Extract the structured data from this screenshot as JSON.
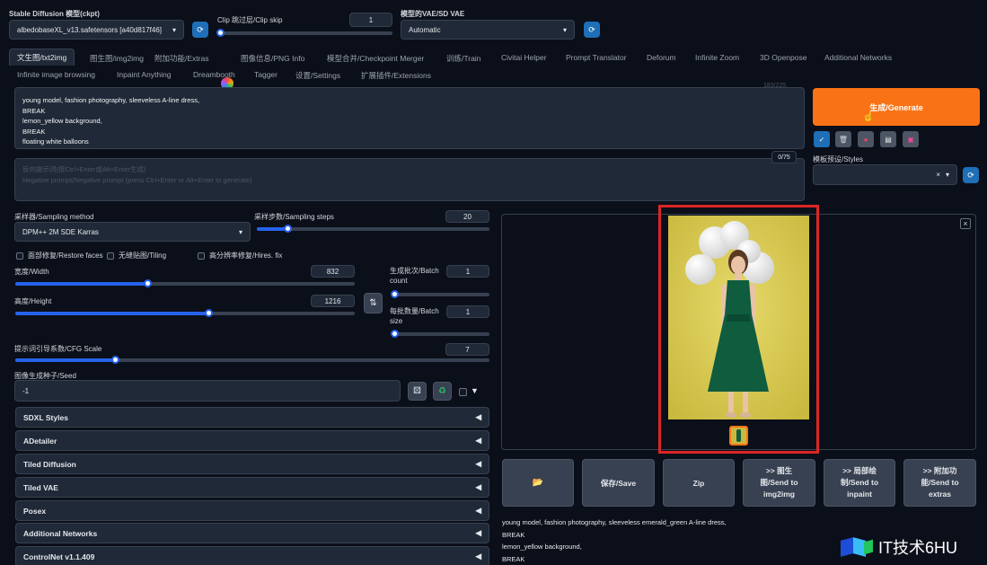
{
  "top": {
    "ckpt_label": "Stable Diffusion 模型(ckpt)",
    "ckpt_value": "albedobaseXL_v13.safetensors [a40d817f46]",
    "clip_label": "Clip 跳过层/Clip skip",
    "clip_value": "1",
    "clip_fraction": 0.0,
    "vae_label": "模型的VAE/SD VAE",
    "vae_value": "Automatic",
    "refresh_glyph": "⟳"
  },
  "tabs_row1": [
    "文生图/txt2img",
    "图生图/img2img",
    "附加功能/Extras",
    "图像信息/PNG Info",
    "模型合并/Checkpoint Merger",
    "训练/Train",
    "Civitai Helper",
    "Prompt Translator",
    "Deforum",
    "Infinite Zoom",
    "3D Openpose",
    "Additional Networks"
  ],
  "tabs_row2": [
    "Infinite image browsing",
    "Inpaint Anything",
    "Dreambooth",
    "Tagger",
    "设置/Settings",
    "扩展插件/Extensions"
  ],
  "prompt": {
    "lines": [
      "young model, fashion photography, sleeveless A-line dress,",
      "BREAK",
      "lemon_yellow background,",
      "BREAK",
      "floating white balloons"
    ],
    "counter": "183/225",
    "neg_placeholder_cn": "反向提示词(按Ctrl+Enter或Alt+Enter生成)",
    "neg_placeholder_en": "Negative prompt(Negative prompt (press Ctrl+Enter or Alt+Enter to generate)",
    "neg_counter": "0/75"
  },
  "generate": {
    "label": "生成/Generate",
    "styles_label": "模板预设/Styles",
    "clear_glyph": "×",
    "dropdown_glyph": "▾",
    "toolbar_icons": [
      "check-icon",
      "trash-icon",
      "red-dot-icon",
      "clipboard-icon",
      "save-icon"
    ]
  },
  "sampling": {
    "method_label": "采样器/Sampling method",
    "method_value": "DPM++ 2M SDE Karras",
    "steps_label": "采样步数/Sampling steps",
    "steps_value": "20",
    "steps_fraction": 0.13
  },
  "options": {
    "restore_faces": "面部修复/Restore faces",
    "tiling": "无缝贴图/Tiling",
    "hires_fix": "高分辨率修复/Hires. fix"
  },
  "dims": {
    "width_label": "宽度/Width",
    "width_value": "832",
    "width_fraction": 0.39,
    "height_label": "高度/Height",
    "height_value": "1216",
    "height_fraction": 0.57,
    "swap_glyph": "⇅",
    "batch_count_label": "生成批次/Batch count",
    "batch_count_value": "1",
    "batch_count_fraction": 0.0,
    "batch_size_label": "每批数量/Batch size",
    "batch_size_value": "1",
    "batch_size_fraction": 0.0
  },
  "cfg": {
    "label": "提示词引导系数/CFG Scale",
    "value": "7",
    "fraction": 0.21
  },
  "seed": {
    "label": "图像生成种子/Seed",
    "value": "-1",
    "extra_glyph": "▼"
  },
  "accordions": [
    "SDXL Styles",
    "ADetailer",
    "Tiled Diffusion",
    "Tiled VAE",
    "Posex",
    "Additional Networks",
    "ControlNet v1.1.409"
  ],
  "accordion_glyph": "◀",
  "output": {
    "close_glyph": "×",
    "buttons": [
      "📂",
      "保存/Save",
      "Zip",
      ">> 图生图/Send to img2img",
      ">> 局部绘制/Send to inpaint",
      ">> 附加功能/Send to extras"
    ],
    "info_lines": [
      "young model, fashion photography, sleeveless emerald_green A-line dress,",
      "BREAK",
      "lemon_yellow background,",
      "BREAK"
    ]
  },
  "watermark": {
    "text": "IT技术6HU"
  },
  "colors": {
    "accent": "#f97316",
    "blue": "#2563eb",
    "highlight": "#dc2626",
    "bg": "#0b0f19"
  }
}
